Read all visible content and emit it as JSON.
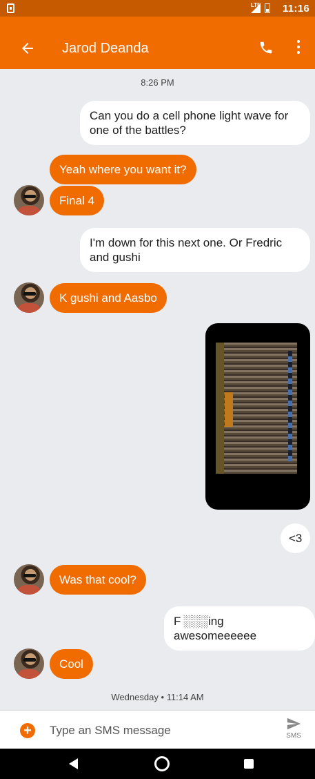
{
  "status_bar": {
    "network": "LTE",
    "time": "11:16"
  },
  "header": {
    "contact_name": "Jarod Deanda"
  },
  "messages": {
    "ts1": "8:26 PM",
    "m1": "Can you do a cell phone light wave for one of the battles?",
    "m2": "Yeah where you want it?",
    "m3": "Final 4",
    "m4": "I'm down for this next one. Or Fredric and gushi",
    "m5": "K gushi and Aasbo",
    "m6": "<3",
    "m7": "Was that cool?",
    "m8": "F ░░░ing awesomeeeeee",
    "m9": "Cool",
    "ts2": "Wednesday • 11:14 AM"
  },
  "compose": {
    "placeholder": "Type an SMS message",
    "send_label": "SMS"
  },
  "colors": {
    "accent": "#f06c00",
    "status_bar": "#c55a00",
    "background": "#e9ebee"
  }
}
